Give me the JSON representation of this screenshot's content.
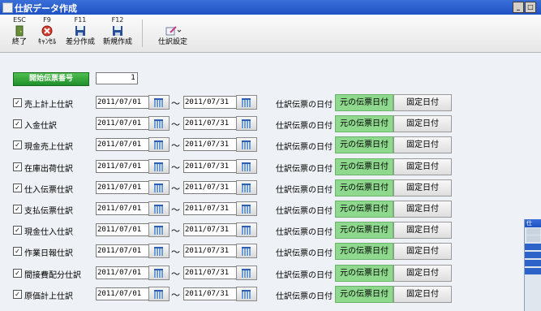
{
  "window": {
    "title": "仕訳データ作成",
    "minimize": "_",
    "restore": "□",
    "close": "×"
  },
  "toolbar": {
    "buttons": [
      {
        "key": "ESC",
        "label": "終了",
        "icon": "exit-door-icon"
      },
      {
        "key": "F9",
        "label": "ｷｬﾝｾﾙ",
        "icon": "cancel-x-icon"
      },
      {
        "key": "F11",
        "label": "差分作成",
        "icon": "floppy-save-icon"
      },
      {
        "key": "F12",
        "label": "新規作成",
        "icon": "floppy-save-icon"
      },
      {
        "key": "",
        "label": "仕訳設定",
        "icon": "settings-brush-icon"
      }
    ]
  },
  "start": {
    "button_label": "開始伝票番号",
    "value": "1"
  },
  "rows": [
    {
      "label": "売上計上仕訳",
      "checked": true,
      "from": "2011/07/01",
      "to": "2011/07/31"
    },
    {
      "label": "入金仕訳",
      "checked": true,
      "from": "2011/07/01",
      "to": "2011/07/31"
    },
    {
      "label": "現金売上仕訳",
      "checked": true,
      "from": "2011/07/01",
      "to": "2011/07/31"
    },
    {
      "label": "在庫出荷仕訳",
      "checked": true,
      "from": "2011/07/01",
      "to": "2011/07/31"
    },
    {
      "label": "仕入伝票仕訳",
      "checked": true,
      "from": "2011/07/01",
      "to": "2011/07/31"
    },
    {
      "label": "支払伝票仕訳",
      "checked": true,
      "from": "2011/07/01",
      "to": "2011/07/31"
    },
    {
      "label": "現金仕入仕訳",
      "checked": true,
      "from": "2011/07/01",
      "to": "2011/07/31"
    },
    {
      "label": "作業日報仕訳",
      "checked": true,
      "from": "2011/07/01",
      "to": "2011/07/31"
    },
    {
      "label": "間接費配分仕訳",
      "checked": true,
      "from": "2011/07/01",
      "to": "2011/07/31"
    },
    {
      "label": "原価計上仕訳",
      "checked": true,
      "from": "2011/07/01",
      "to": "2011/07/31"
    }
  ],
  "common": {
    "tilde": "～",
    "date_label": "仕訳伝票の日付",
    "orig_button": "元の伝票日付",
    "fixed_button": "固定日付",
    "check_mark": "✓"
  },
  "background_window": {
    "title": "仕"
  },
  "colors": {
    "title_bar": "#1e52c4",
    "start_button": "#2e9e3a",
    "orig_date_button": "#8ed98e"
  }
}
